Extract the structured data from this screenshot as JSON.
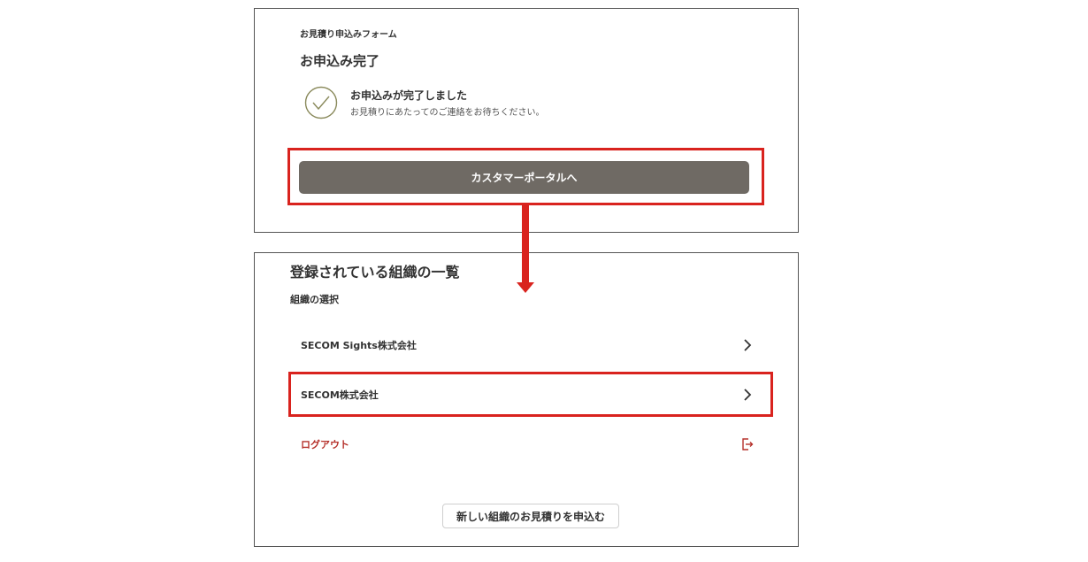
{
  "completion_panel": {
    "form_subtitle": "お見積り申込みフォーム",
    "form_title": "お申込み完了",
    "status_icon": "check-circle-icon",
    "message_title": "お申込みが完了しました",
    "message_body": "お見積りにあたってのご連絡をお待ちください。",
    "portal_button_label": "カスタマーポータルへ"
  },
  "org_panel": {
    "title": "登録されている組織の一覧",
    "subtitle": "組織の選択",
    "organizations": [
      {
        "name": "SECOM Sights株式会社",
        "icon": "chevron-right-icon"
      },
      {
        "name": "SECOM株式会社",
        "icon": "chevron-right-icon"
      }
    ],
    "logout": {
      "label": "ログアウト",
      "icon": "logout-icon"
    },
    "new_quote_button_label": "新しい組織のお見積りを申込む"
  },
  "colors": {
    "highlight": "#d9231e",
    "button_bg": "#6f6a64",
    "check_accent": "#8a8a5c",
    "logout_text": "#b5302a"
  }
}
